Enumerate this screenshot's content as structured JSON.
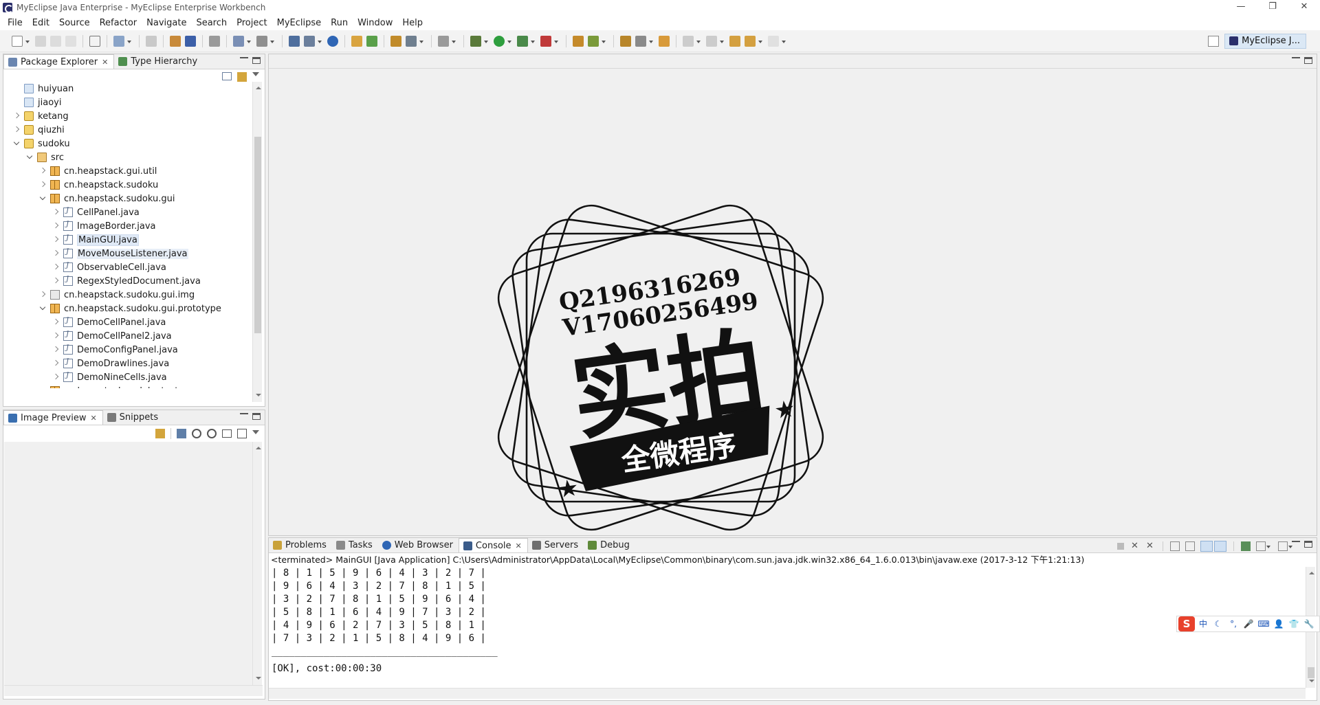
{
  "window": {
    "title": "MyEclipse Java Enterprise - MyEclipse Enterprise Workbench",
    "controls": [
      "—",
      "❐",
      "✕"
    ]
  },
  "menubar": [
    "File",
    "Edit",
    "Source",
    "Refactor",
    "Navigate",
    "Search",
    "Project",
    "MyEclipse",
    "Run",
    "Window",
    "Help"
  ],
  "perspective": {
    "label": "MyEclipse J..."
  },
  "package_explorer": {
    "tabs": [
      {
        "label": "Package Explorer",
        "active": true,
        "closable": true
      },
      {
        "label": "Type Hierarchy",
        "active": false,
        "closable": false
      }
    ],
    "tree": [
      {
        "label": "huiyuan",
        "indent": 0,
        "icon": "folder-icon",
        "twisty": "none"
      },
      {
        "label": "jiaoyi",
        "indent": 0,
        "icon": "folder-icon",
        "twisty": "none"
      },
      {
        "label": "ketang",
        "indent": 0,
        "icon": "project-icon",
        "twisty": "closed"
      },
      {
        "label": "qiuzhi",
        "indent": 0,
        "icon": "project-icon",
        "twisty": "closed"
      },
      {
        "label": "sudoku",
        "indent": 0,
        "icon": "project-icon",
        "twisty": "open"
      },
      {
        "label": "src",
        "indent": 1,
        "icon": "source-folder-icon",
        "twisty": "open"
      },
      {
        "label": "cn.heapstack.gui.util",
        "indent": 2,
        "icon": "package-icon",
        "twisty": "closed"
      },
      {
        "label": "cn.heapstack.sudoku",
        "indent": 2,
        "icon": "package-icon",
        "twisty": "closed"
      },
      {
        "label": "cn.heapstack.sudoku.gui",
        "indent": 2,
        "icon": "package-icon",
        "twisty": "open"
      },
      {
        "label": "CellPanel.java",
        "indent": 3,
        "icon": "java-file-icon",
        "twisty": "closed"
      },
      {
        "label": "ImageBorder.java",
        "indent": 3,
        "icon": "java-file-icon",
        "twisty": "closed"
      },
      {
        "label": "MainGUI.java",
        "indent": 3,
        "icon": "java-file-icon",
        "twisty": "closed",
        "state": "selected"
      },
      {
        "label": "MoveMouseListener.java",
        "indent": 3,
        "icon": "java-file-icon",
        "twisty": "closed",
        "state": "hover"
      },
      {
        "label": "ObservableCell.java",
        "indent": 3,
        "icon": "java-file-icon",
        "twisty": "closed"
      },
      {
        "label": "RegexStyledDocument.java",
        "indent": 3,
        "icon": "java-file-icon",
        "twisty": "closed"
      },
      {
        "label": "cn.heapstack.sudoku.gui.img",
        "indent": 2,
        "icon": "image-package-icon",
        "twisty": "closed"
      },
      {
        "label": "cn.heapstack.sudoku.gui.prototype",
        "indent": 2,
        "icon": "package-icon",
        "twisty": "open"
      },
      {
        "label": "DemoCellPanel.java",
        "indent": 3,
        "icon": "java-file-icon",
        "twisty": "closed"
      },
      {
        "label": "DemoCellPanel2.java",
        "indent": 3,
        "icon": "java-file-icon",
        "twisty": "closed"
      },
      {
        "label": "DemoConfigPanel.java",
        "indent": 3,
        "icon": "java-file-icon",
        "twisty": "closed"
      },
      {
        "label": "DemoDrawlines.java",
        "indent": 3,
        "icon": "java-file-icon",
        "twisty": "closed"
      },
      {
        "label": "DemoNineCells.java",
        "indent": 3,
        "icon": "java-file-icon",
        "twisty": "closed"
      },
      {
        "label": "cn.heapstack.sudoku.test",
        "indent": 2,
        "icon": "package-icon",
        "twisty": "open"
      }
    ]
  },
  "image_preview": {
    "tabs": [
      {
        "label": "Image Preview",
        "active": true,
        "closable": true
      },
      {
        "label": "Snippets",
        "active": false,
        "closable": false
      }
    ]
  },
  "bottom_panel": {
    "tabs": [
      {
        "label": "Problems",
        "active": false,
        "closable": false
      },
      {
        "label": "Tasks",
        "active": false,
        "closable": false
      },
      {
        "label": "Web Browser",
        "active": false,
        "closable": false
      },
      {
        "label": "Console",
        "active": true,
        "closable": true
      },
      {
        "label": "Servers",
        "active": false,
        "closable": false
      },
      {
        "label": "Debug",
        "active": false,
        "closable": false
      }
    ],
    "console_status": "<terminated> MainGUI [Java Application] C:\\Users\\Administrator\\AppData\\Local\\MyEclipse\\Common\\binary\\com.sun.java.jdk.win32.x86_64_1.6.0.013\\bin\\javaw.exe (2017-3-12 下午1:21:13)",
    "console_lines": [
      "| 8 | 1 | 5 | 9 | 6 | 4 | 3 | 2 | 7 |",
      "| 9 | 6 | 4 | 3 | 2 | 7 | 8 | 1 | 5 |",
      "| 3 | 2 | 7 | 8 | 1 | 5 | 9 | 6 | 4 |",
      "| 5 | 8 | 1 | 6 | 4 | 9 | 7 | 3 | 2 |",
      "| 4 | 9 | 6 | 2 | 7 | 3 | 5 | 8 | 1 |",
      "| 7 | 3 | 2 | 1 | 5 | 8 | 4 | 9 | 6 |",
      "_______________________________________",
      "[OK], cost:00:00:30"
    ]
  },
  "watermark": {
    "line1": "Q2196316269",
    "line2": "V17060256499",
    "main": "实拍",
    "ribbon": "全微程序"
  },
  "ime_bar": {
    "logo": "S",
    "items": [
      "中",
      "☾",
      "°,",
      "🎤",
      "⌨",
      "👤",
      "👕",
      "🔧"
    ]
  }
}
